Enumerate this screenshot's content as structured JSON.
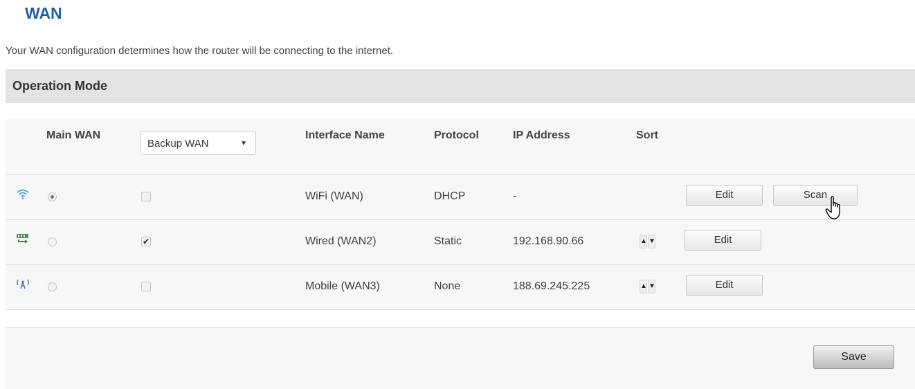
{
  "page": {
    "title": "WAN",
    "intro": "Your WAN configuration determines how the router will be connecting to the internet."
  },
  "section": {
    "title": "Operation Mode"
  },
  "table": {
    "headers": {
      "main_wan": "Main WAN",
      "backup_wan": "Backup WAN",
      "interface_name": "Interface Name",
      "protocol": "Protocol",
      "ip_address": "IP Address",
      "sort": "Sort"
    },
    "rows": [
      {
        "icon": "wifi-icon",
        "main_selected": true,
        "backup_checked": false,
        "interface": "WiFi (WAN)",
        "protocol": "DHCP",
        "ip": "-",
        "sortable": false,
        "edit_label": "Edit",
        "scan_label": "Scan"
      },
      {
        "icon": "wired-icon",
        "main_selected": false,
        "backup_checked": true,
        "interface": "Wired (WAN2)",
        "protocol": "Static",
        "ip": "192.168.90.66",
        "sortable": true,
        "edit_label": "Edit"
      },
      {
        "icon": "mobile-icon",
        "main_selected": false,
        "backup_checked": false,
        "interface": "Mobile (WAN3)",
        "protocol": "None",
        "ip": "188.69.245.225",
        "sortable": true,
        "edit_label": "Edit"
      }
    ]
  },
  "footer": {
    "save_label": "Save"
  },
  "colors": {
    "title": "#1f5fa6",
    "header_bg": "#e3e3e3",
    "table_bg": "#f7f7f7"
  }
}
